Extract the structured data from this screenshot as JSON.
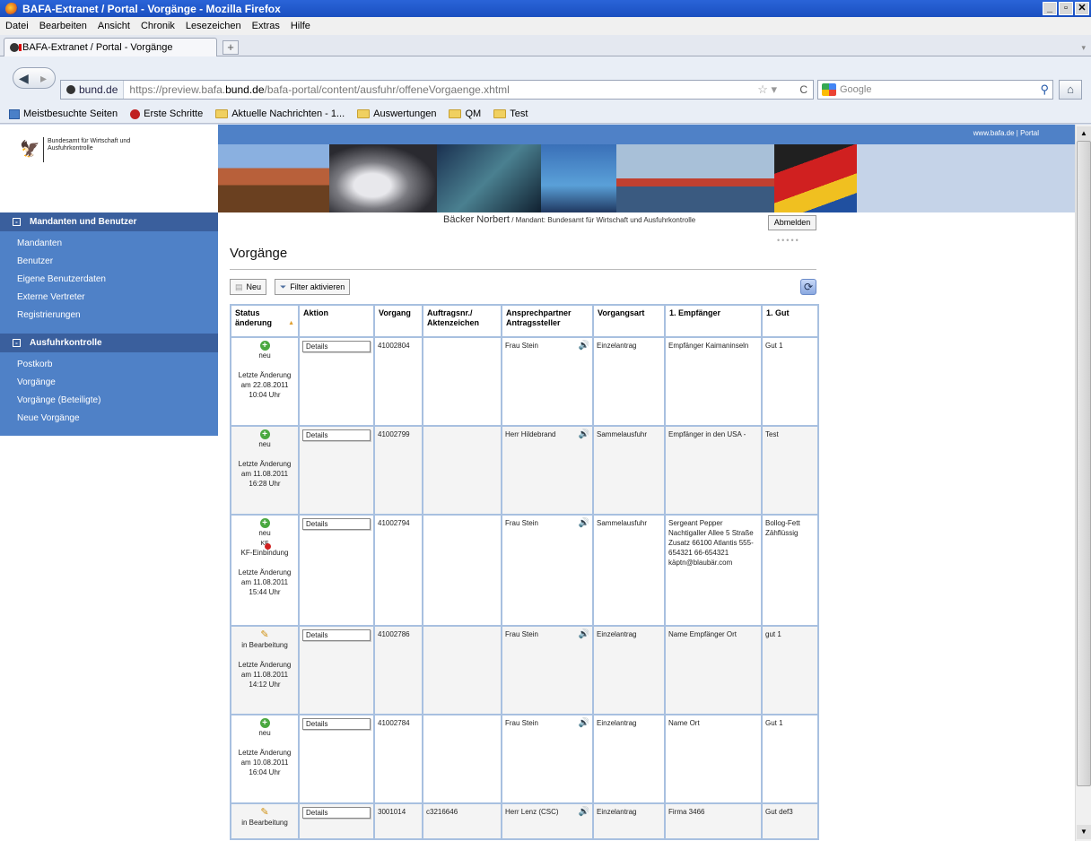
{
  "browser": {
    "window_title": "BAFA-Extranet / Portal - Vorgänge - Mozilla Firefox",
    "menu": [
      "Datei",
      "Bearbeiten",
      "Ansicht",
      "Chronik",
      "Lesezeichen",
      "Extras",
      "Hilfe"
    ],
    "tab_title": "BAFA-Extranet / Portal - Vorgänge",
    "site_identity": "bund.de",
    "url_prefix": "https://preview.bafa.",
    "url_domain": "bund.de",
    "url_path": "/bafa-portal/content/ausfuhr/offeneVorgaenge.xhtml",
    "search_placeholder": "Google",
    "bookmarks": [
      "Meistbesuchte Seiten",
      "Erste Schritte",
      "Aktuelle Nachrichten - 1...",
      "Auswertungen",
      "QM",
      "Test"
    ]
  },
  "header": {
    "logo_text": "Bundesamt für Wirtschaft und Ausfuhrkontrolle",
    "top_links": "www.bafa.de | Portal"
  },
  "sidebar": {
    "section1_title": "Mandanten und Benutzer",
    "section1_items": [
      "Mandanten",
      "Benutzer",
      "Eigene Benutzerdaten",
      "Externe Vertreter",
      "Registrierungen"
    ],
    "section2_title": "Ausfuhrkontrolle",
    "section2_items": [
      "Postkorb",
      "Vorgänge",
      "Vorgänge (Beteiligte)",
      "Neue Vorgänge"
    ]
  },
  "user": {
    "name": "Bäcker Norbert",
    "mandant": " / Mandant: Bundesamt für Wirtschaft und Ausfuhrkontrolle",
    "logout_label": "Abmelden"
  },
  "main": {
    "title": "Vorgänge",
    "new_label": "Neu",
    "filter_label": "Filter aktivieren",
    "columns": [
      "Status änderung",
      "Aktion",
      "Vorgang",
      "Auftragsnr./ Aktenzeichen",
      "Ansprechpartner Antragssteller",
      "Vorgangsart",
      "1. Empfänger",
      "1. Gut"
    ],
    "rows": [
      {
        "status": "neu",
        "kf": "",
        "changed": "Letzte Änderung am 22.08.2011 10:04 Uhr",
        "action": "Details",
        "vorgang": "41002804",
        "auftrag": "",
        "contact": "Frau Stein",
        "art": "Einzelantrag",
        "empf": "Empfänger Kaimaninseln",
        "gut": "Gut 1",
        "icon": "plus"
      },
      {
        "status": "neu",
        "kf": "",
        "changed": "Letzte Änderung am 11.08.2011 16:28 Uhr",
        "action": "Details",
        "vorgang": "41002799",
        "auftrag": "",
        "contact": "Herr Hildebrand",
        "art": "Sammelausfuhr",
        "empf": "Empfänger in den USA -",
        "gut": "Test",
        "icon": "plus"
      },
      {
        "status": "neu",
        "kf": "KF-Einbindung",
        "changed": "Letzte Änderung am 11.08.2011 15:44 Uhr",
        "action": "Details",
        "vorgang": "41002794",
        "auftrag": "",
        "contact": "Frau Stein",
        "art": "Sammelausfuhr",
        "empf": "Sergeant Pepper Nachtigaller Allee 5 Straße Zusatz 66100 Atlantis 555-654321 66-654321 käptn@blaubär.com",
        "gut": "Bollog-Fett Zähflüssig",
        "icon": "plus"
      },
      {
        "status": "in Bearbeitung",
        "kf": "",
        "changed": "Letzte Änderung am 11.08.2011 14:12 Uhr",
        "action": "Details",
        "vorgang": "41002786",
        "auftrag": "",
        "contact": "Frau Stein",
        "art": "Einzelantrag",
        "empf": "Name Empfänger Ort",
        "gut": "gut 1",
        "icon": "pencil"
      },
      {
        "status": "neu",
        "kf": "",
        "changed": "Letzte Änderung am 10.08.2011 16:04 Uhr",
        "action": "Details",
        "vorgang": "41002784",
        "auftrag": "",
        "contact": "Frau Stein",
        "art": "Einzelantrag",
        "empf": "Name Ort",
        "gut": "Gut 1",
        "icon": "plus"
      },
      {
        "status": "in Bearbeitung",
        "kf": "",
        "changed": "",
        "action": "Details",
        "vorgang": "3001014",
        "auftrag": "c3216646",
        "contact": "Herr Lenz (CSC)",
        "art": "Einzelantrag",
        "empf": "Firma 3466",
        "gut": "Gut def3",
        "icon": "pencil"
      }
    ]
  }
}
